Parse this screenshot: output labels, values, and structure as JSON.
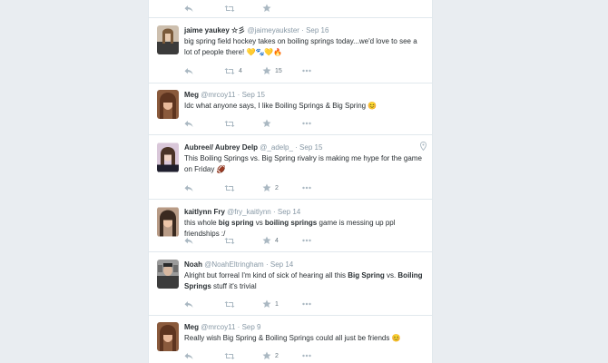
{
  "tweets": [
    {
      "fullname": "jaime yaukey ☆彡",
      "username": "@jaimeyaukster",
      "time": "Sep 16",
      "text": "big spring field hockey takes on boiling springs today...we'd love to see a lot of people there! 💛🐾💛🔥",
      "retweets": "4",
      "favorites": "15"
    },
    {
      "fullname": "Meg",
      "username": "@mrcoy11",
      "time": "Sep 15",
      "text": "Idc what anyone says, I like Boiling Springs & Big Spring 😊",
      "retweets": "",
      "favorites": ""
    },
    {
      "fullname": "Aubree// Aubrey Delp",
      "username": "@_adelp_",
      "time": "Sep 15",
      "text": "This Boiling Springs vs. Big Spring rivalry is making me hype for the game on Friday 🏈",
      "retweets": "",
      "favorites": "2"
    },
    {
      "fullname": "kaitlynn Fry",
      "username": "@fry_kaitlynn",
      "time": "Sep 14",
      "text_parts": [
        "this whole ",
        "big spring",
        " vs ",
        "boiling springs",
        " game is messing up ppl friendships :/"
      ],
      "retweets": "",
      "favorites": "4"
    },
    {
      "fullname": "Noah",
      "username": "@NoahEltringham",
      "time": "Sep 14",
      "text_parts": [
        "Alright but forreal I'm kind of sick of hearing all this ",
        "Big Spring",
        " vs. ",
        "Boiling Springs",
        " stuff it's trivial"
      ],
      "retweets": "",
      "favorites": "1"
    },
    {
      "fullname": "Meg",
      "username": "@mrcoy11",
      "time": "Sep 9",
      "text": "Really wish Big Spring & Boiling Springs could all just be friends 😊",
      "retweets": "",
      "favorites": "2"
    }
  ],
  "separator": "·",
  "icons": {
    "reply": "reply-icon",
    "retweet": "retweet-icon",
    "favorite": "star-icon",
    "more": "more-icon",
    "geo": "location-pin-icon"
  },
  "colors": {
    "icon": "#aab8c2",
    "muted": "#8899a6",
    "text": "#292f33",
    "border": "#e1e8ed",
    "background": "#e9edf1"
  }
}
